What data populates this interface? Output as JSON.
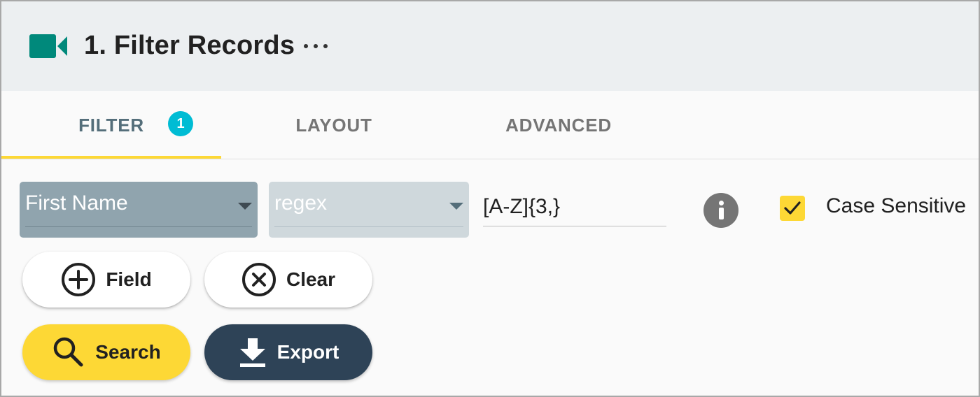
{
  "header": {
    "icon": "video-camera-icon",
    "title": "1. Filter Records",
    "more_icon": "more-horizontal-icon"
  },
  "tabs": [
    {
      "label": "FILTER",
      "active": true,
      "badge": "1"
    },
    {
      "label": "LAYOUT",
      "active": false
    },
    {
      "label": "ADVANCED",
      "active": false
    }
  ],
  "filter": {
    "field_select": {
      "value": "First Name"
    },
    "operator_select": {
      "value": "regex"
    },
    "value_input": {
      "value": "[A-Z]{3,}"
    },
    "info_icon": "info-icon",
    "case_sensitive": {
      "label": "Case Sensitive",
      "checked": true
    }
  },
  "buttons": {
    "add_field": {
      "label": "Field",
      "icon": "add-circle-icon"
    },
    "clear": {
      "label": "Clear",
      "icon": "cancel-circle-icon"
    },
    "search": {
      "label": "Search",
      "icon": "search-icon"
    },
    "export": {
      "label": "Export",
      "icon": "download-icon"
    }
  },
  "colors": {
    "accent": "#fdd835",
    "badge": "#00bcd4",
    "brand_icon": "#00897b",
    "export_button": "#2e4357",
    "field_select": "#90a4ae",
    "operator_select": "#cfd8dc"
  }
}
